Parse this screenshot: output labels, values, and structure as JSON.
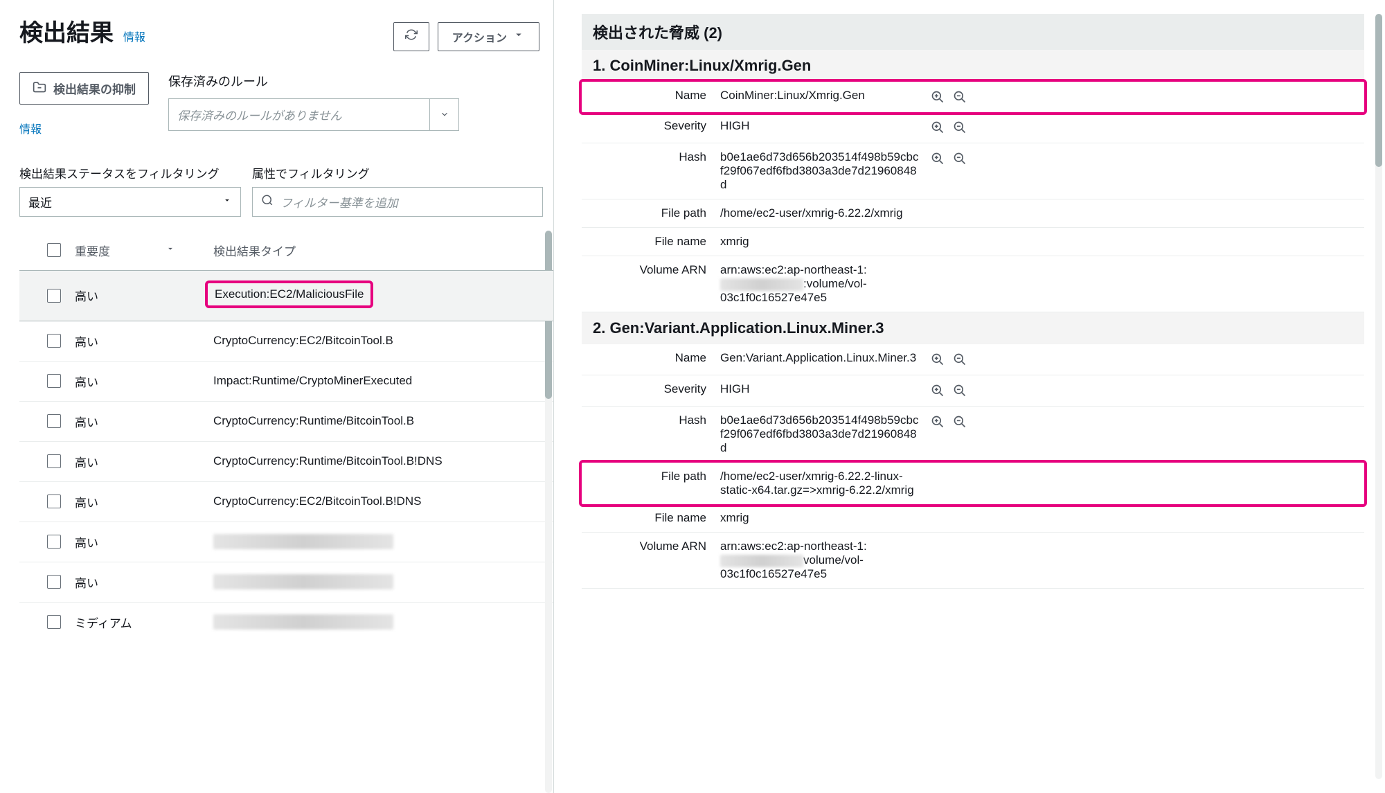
{
  "left": {
    "title": "検出結果",
    "info": "情報",
    "refresh_label": "",
    "actions_label": "アクション",
    "suppress_label": "検出結果の抑制",
    "saved_rules_label": "保存済みのルール",
    "saved_rules_placeholder": "保存済みのルールがありません",
    "info2": "情報",
    "filter_status_label": "検出結果ステータスをフィルタリング",
    "filter_status_value": "最近",
    "filter_attr_label": "属性でフィルタリング",
    "filter_attr_placeholder": "フィルター基準を追加",
    "th_severity": "重要度",
    "th_type": "検出結果タイプ",
    "rows": [
      {
        "sev": "高い",
        "type": "Execution:EC2/MaliciousFile",
        "selected": true,
        "highlight": true
      },
      {
        "sev": "高い",
        "type": "CryptoCurrency:EC2/BitcoinTool.B"
      },
      {
        "sev": "高い",
        "type": "Impact:Runtime/CryptoMinerExecuted"
      },
      {
        "sev": "高い",
        "type": "CryptoCurrency:Runtime/BitcoinTool.B"
      },
      {
        "sev": "高い",
        "type": "CryptoCurrency:Runtime/BitcoinTool.B!DNS"
      },
      {
        "sev": "高い",
        "type": "CryptoCurrency:EC2/BitcoinTool.B!DNS"
      },
      {
        "sev": "高い",
        "type": "",
        "redacted": true
      },
      {
        "sev": "高い",
        "type": "",
        "redacted": true
      },
      {
        "sev": "ミディアム",
        "type": "",
        "redacted": true
      }
    ]
  },
  "right": {
    "header": "検出された脅威 (2)",
    "threats": [
      {
        "title": "1. CoinMiner:Linux/Xmrig.Gen",
        "rows": [
          {
            "key": "Name",
            "val": "CoinMiner:Linux/Xmrig.Gen",
            "zoom": true,
            "highlight": true
          },
          {
            "key": "Severity",
            "val": "HIGH",
            "zoom": true
          },
          {
            "key": "Hash",
            "val": "b0e1ae6d73d656b203514f498b59cbcf29f067edf6fbd3803a3de7d21960848d",
            "zoom": true
          },
          {
            "key": "File path",
            "val": "/home/ec2-user/xmrig-6.22.2/xmrig"
          },
          {
            "key": "File name",
            "val": "xmrig"
          },
          {
            "key": "Volume ARN",
            "val_prefix": "arn:aws:ec2:ap-northeast-1:",
            "val_suffix": ":volume/vol-03c1f0c16527e47e5",
            "redacted": true
          }
        ]
      },
      {
        "title": "2. Gen:Variant.Application.Linux.Miner.3",
        "rows": [
          {
            "key": "Name",
            "val": "Gen:Variant.Application.Linux.Miner.3",
            "zoom": true
          },
          {
            "key": "Severity",
            "val": "HIGH",
            "zoom": true
          },
          {
            "key": "Hash",
            "val": "b0e1ae6d73d656b203514f498b59cbcf29f067edf6fbd3803a3de7d21960848d",
            "zoom": true
          },
          {
            "key": "File path",
            "val": "/home/ec2-user/xmrig-6.22.2-linux-static-x64.tar.gz=>xmrig-6.22.2/xmrig",
            "highlight": true
          },
          {
            "key": "File name",
            "val": "xmrig"
          },
          {
            "key": "Volume ARN",
            "val_prefix": "arn:aws:ec2:ap-northeast-1:",
            "val_suffix": "volume/vol-03c1f0c16527e47e5",
            "redacted": true
          }
        ]
      }
    ]
  }
}
